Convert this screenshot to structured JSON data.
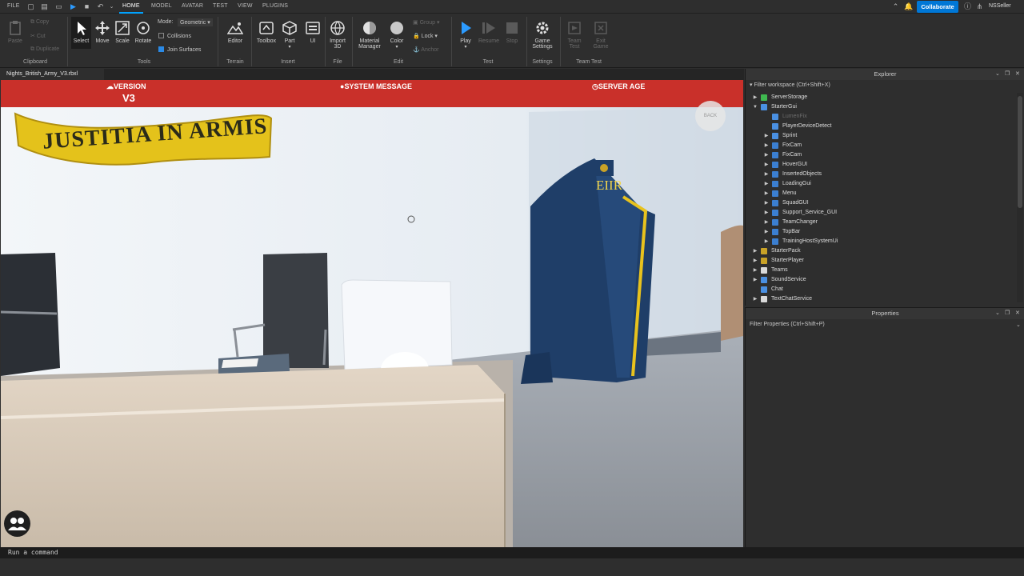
{
  "menubar": {
    "file": "FILE",
    "tabs": [
      "HOME",
      "MODEL",
      "AVATAR",
      "TEST",
      "VIEW",
      "PLUGINS"
    ],
    "collaborate": "Collaborate",
    "user": "NSSeller"
  },
  "ribbon": {
    "clipboard": {
      "paste": "Paste",
      "copy": "Copy",
      "cut": "Cut",
      "duplicate": "Duplicate",
      "group": "Clipboard"
    },
    "tools": {
      "select": "Select",
      "move": "Move",
      "scale": "Scale",
      "rotate": "Rotate",
      "mode_label": "Mode:",
      "mode_value": "Geometric",
      "collisions": "Collisions",
      "join_surfaces": "Join Surfaces",
      "group": "Tools"
    },
    "terrain": {
      "editor": "Editor",
      "group": "Terrain"
    },
    "insert": {
      "toolbox": "Toolbox",
      "part": "Part",
      "ui": "UI",
      "group": "Insert"
    },
    "file": {
      "import_line1": "Import",
      "import_line2": "3D",
      "group": "File"
    },
    "edit": {
      "material_line1": "Material",
      "material_line2": "Manager",
      "color": "Color",
      "grp": "Group",
      "lock": "Lock",
      "anchor": "Anchor",
      "group": "Edit"
    },
    "test": {
      "play": "Play",
      "resume": "Resume",
      "stop": "Stop",
      "group": "Test"
    },
    "settings": {
      "game_line1": "Game",
      "game_line2": "Settings",
      "group": "Settings"
    },
    "team_test": {
      "team_line1": "Team",
      "team_line2": "Test",
      "exit_line1": "Exit",
      "exit_line2": "Game",
      "group": "Team Test"
    }
  },
  "file_tab": "Nights_British_Army_V3.rbxl",
  "viewport": {
    "version_label": "VERSION",
    "version_value": "V3",
    "system_message": "SYSTEM MESSAGE",
    "server_age": "SERVER AGE",
    "back": "BACK",
    "motto": "JUSTITIA IN ARMIS",
    "cypher": "EIIR"
  },
  "explorer": {
    "title": "Explorer",
    "filter": "Filter workspace (Ctrl+Shift+X)",
    "items": [
      {
        "label": "ServerStorage",
        "depth": 0,
        "arrow": "right",
        "icon": "folder-icon",
        "color": "#3fb950"
      },
      {
        "label": "StarterGui",
        "depth": 0,
        "arrow": "down",
        "icon": "folder-icon",
        "color": "#4a90e2"
      },
      {
        "label": "LumenFix",
        "depth": 1,
        "arrow": "none",
        "icon": "script-icon",
        "color": "#4a90e2",
        "faded": true
      },
      {
        "label": "PlayerDeviceDetect",
        "depth": 1,
        "arrow": "none",
        "icon": "script-icon",
        "color": "#4a90e2"
      },
      {
        "label": "Sprint",
        "depth": 1,
        "arrow": "right",
        "icon": "script-icon",
        "color": "#4a90e2"
      },
      {
        "label": "FixCam",
        "depth": 1,
        "arrow": "right",
        "icon": "screengui-icon",
        "color": "#3b7fd1"
      },
      {
        "label": "FixCam",
        "depth": 1,
        "arrow": "right",
        "icon": "screengui-icon",
        "color": "#3b7fd1"
      },
      {
        "label": "HoverGUI",
        "depth": 1,
        "arrow": "right",
        "icon": "screengui-icon",
        "color": "#3b7fd1"
      },
      {
        "label": "InsertedObjects",
        "depth": 1,
        "arrow": "right",
        "icon": "screengui-icon",
        "color": "#3b7fd1"
      },
      {
        "label": "LoadingGui",
        "depth": 1,
        "arrow": "right",
        "icon": "screengui-icon",
        "color": "#3b7fd1"
      },
      {
        "label": "Menu",
        "depth": 1,
        "arrow": "right",
        "icon": "screengui-icon",
        "color": "#3b7fd1"
      },
      {
        "label": "SquadGUI",
        "depth": 1,
        "arrow": "right",
        "icon": "screengui-icon",
        "color": "#3b7fd1"
      },
      {
        "label": "Support_Service_GUI",
        "depth": 1,
        "arrow": "right",
        "icon": "screengui-icon",
        "color": "#3b7fd1"
      },
      {
        "label": "TeamChanger",
        "depth": 1,
        "arrow": "right",
        "icon": "screengui-icon",
        "color": "#3b7fd1"
      },
      {
        "label": "TopBar",
        "depth": 1,
        "arrow": "right",
        "icon": "screengui-icon",
        "color": "#3b7fd1"
      },
      {
        "label": "TrainingHostSystemUi",
        "depth": 1,
        "arrow": "right",
        "icon": "screengui-icon",
        "color": "#3b7fd1"
      },
      {
        "label": "StarterPack",
        "depth": 0,
        "arrow": "right",
        "icon": "folder-icon",
        "color": "#c9a227"
      },
      {
        "label": "StarterPlayer",
        "depth": 0,
        "arrow": "right",
        "icon": "folder-icon",
        "color": "#c9a227"
      },
      {
        "label": "Teams",
        "depth": 0,
        "arrow": "right",
        "icon": "teams-icon",
        "color": "#d9d9d9"
      },
      {
        "label": "SoundService",
        "depth": 0,
        "arrow": "right",
        "icon": "sound-icon",
        "color": "#4a90e2"
      },
      {
        "label": "Chat",
        "depth": 0,
        "arrow": "none",
        "icon": "chat-icon",
        "color": "#4a90e2"
      },
      {
        "label": "TextChatService",
        "depth": 0,
        "arrow": "right",
        "icon": "chat-icon",
        "color": "#d9d9d9"
      }
    ]
  },
  "properties": {
    "title": "Properties",
    "filter": "Filter Properties (Ctrl+Shift+P)"
  },
  "command_bar": {
    "placeholder": "Run a command"
  }
}
